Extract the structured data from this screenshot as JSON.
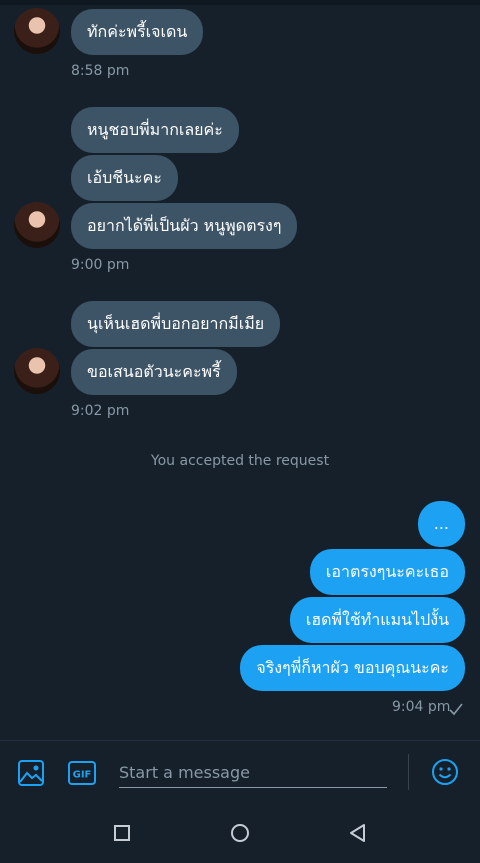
{
  "messages": {
    "group1": {
      "m1": "ทักค่ะพรี้เจเดน",
      "time": "8:58 pm"
    },
    "group2": {
      "m1": "หนูชอบพี่มากเลยค่ะ",
      "m2": "เอ้บชีนะคะ",
      "m3": "อยากได้พี่เป็นผัว หนูพูดตรงๆ",
      "time": "9:00 pm"
    },
    "group3": {
      "m1": "นุเห็นเฮดพี่บอกอยากมีเมีย",
      "m2": "ขอเสนอตัวนะคะพรี้",
      "time": "9:02 pm"
    },
    "system": "You accepted the request",
    "outgoing": {
      "m1": "...",
      "m2": "เอาตรงๆนะคะเธอ",
      "m3": "เฮดพี่ใช้ทำแมนไปงั้น",
      "m4": "จริงๆพี่ก็หาผัว ขอบคุณนะคะ",
      "time": "9:04 pm"
    }
  },
  "composer": {
    "placeholder": "Start a message"
  },
  "icons": {
    "image": "image-icon",
    "gif": "gif-icon",
    "gif_label": "GIF",
    "emoji": "emoji-icon",
    "sent": "checkmark-icon"
  },
  "colors": {
    "background": "#15202b",
    "incoming": "#3d5466",
    "outgoing": "#1da1f2",
    "accent": "#1da1f2"
  }
}
